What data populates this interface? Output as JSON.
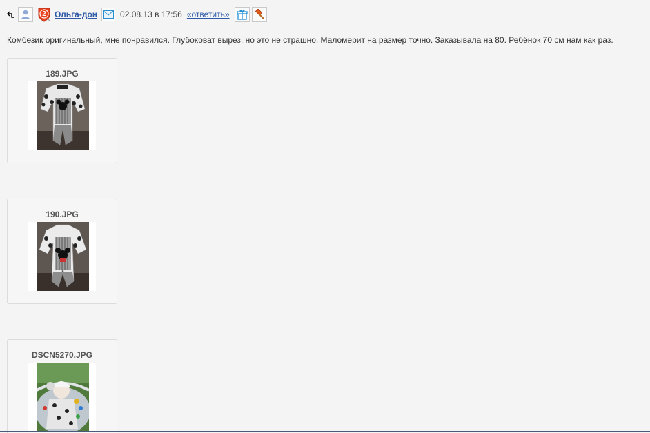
{
  "header": {
    "username": "Ольга-дон",
    "rank_number": "2",
    "date": "02.08.13 в 17:56",
    "reply_label": "«ответить»"
  },
  "comment": {
    "text": "Комбезик оригинальный, мне понравился. Глубоковат вырез, но это не страшно. Маломерит на размер точно. Заказывала на 80. Ребёнок 70 см нам как раз."
  },
  "attachments": [
    {
      "filename": "189.JPG"
    },
    {
      "filename": "190.JPG"
    },
    {
      "filename": "DSCN5270.JPG"
    }
  ],
  "colors": {
    "link": "#2e5aa8",
    "background": "#f4f4f4",
    "rank_badge": "#e8441f"
  },
  "icons": [
    "back-arrow-icon",
    "user-avatar-icon",
    "rank-badge-icon",
    "envelope-icon",
    "gift-icon",
    "hammer-icon"
  ]
}
